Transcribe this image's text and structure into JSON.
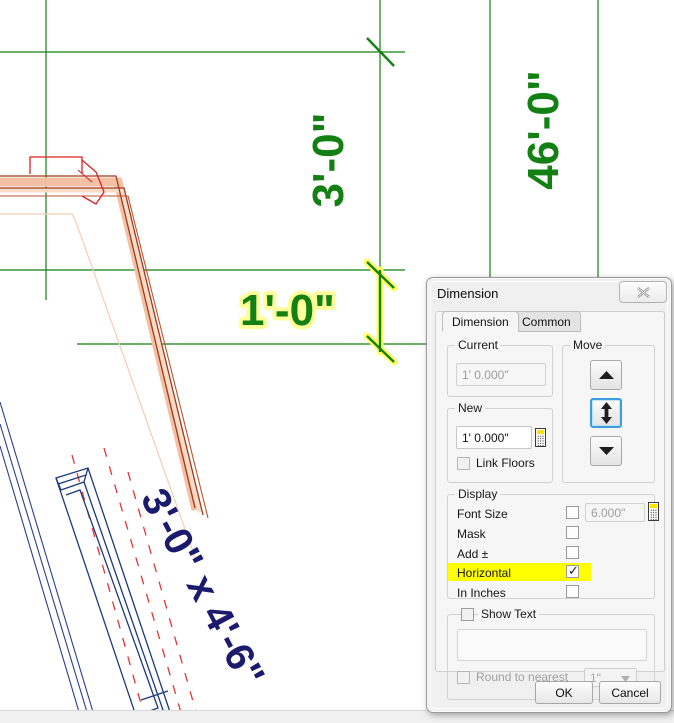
{
  "drawing": {
    "colors": {
      "green": "#128012",
      "navy": "#1b1b6e",
      "red": "#cc2222",
      "salmon": "#f3c0a4",
      "highlight": "#ffff66"
    },
    "dimension_labels": [
      {
        "id": "dim-3-0-vertical",
        "text": "3'-0\"",
        "color": "#128012",
        "rotated": "-90"
      },
      {
        "id": "dim-46-0-vertical",
        "text": "46'-0\"",
        "color": "#128012",
        "rotated": "-90"
      },
      {
        "id": "dim-1-0-selected",
        "text": "1'-0\"",
        "color": "#128012",
        "rotated": "0"
      },
      {
        "id": "door-size-label",
        "text": "3'-0\" x 4'-6\"",
        "color": "#1b1b6e",
        "rotated": "-62"
      }
    ]
  },
  "dialog": {
    "title": "Dimension",
    "close_label": "Close",
    "tabs": [
      {
        "label": "Dimension",
        "active": true
      },
      {
        "label": "Common",
        "active": false
      }
    ],
    "current": {
      "group_label": "Current",
      "value": "1' 0.000\""
    },
    "new": {
      "group_label": "New",
      "value": "1' 0.000\"",
      "link_floors_label": "Link Floors",
      "link_floors_checked": false,
      "calculator_icon": "calculator-icon"
    },
    "move": {
      "group_label": "Move",
      "up_icon": "triangle-up-icon",
      "both_icon": "arrow-up-down-icon",
      "down_icon": "triangle-down-icon"
    },
    "display": {
      "group_label": "Display",
      "rows": [
        {
          "label": "Font Size",
          "checked": false,
          "highlighted": false,
          "value": "6.000\"",
          "has_field": true,
          "has_calc": true
        },
        {
          "label": "Mask",
          "checked": false,
          "highlighted": false,
          "has_field": false
        },
        {
          "label": "Add ±",
          "checked": false,
          "highlighted": false,
          "has_field": false
        },
        {
          "label": "Horizontal",
          "checked": true,
          "highlighted": true,
          "has_field": false
        },
        {
          "label": "In Inches",
          "checked": false,
          "highlighted": false,
          "has_field": false
        }
      ]
    },
    "show_text": {
      "label": "Show Text",
      "checked": false,
      "text_value": "",
      "round_label": "Round to nearest",
      "round_checked": false,
      "round_value": "1\""
    },
    "buttons": {
      "ok": "OK",
      "cancel": "Cancel"
    }
  }
}
